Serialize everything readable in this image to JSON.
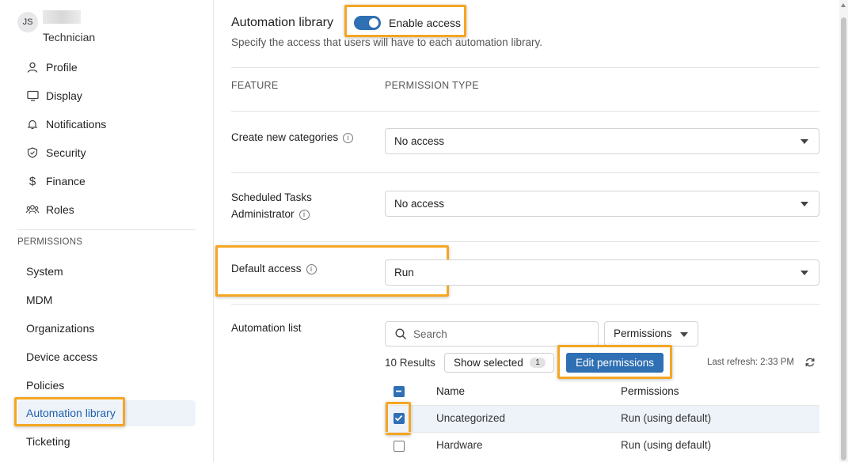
{
  "user": {
    "initials": "JS",
    "role": "Technician"
  },
  "sidebar": {
    "items": [
      {
        "label": "Profile",
        "icon": "person-icon"
      },
      {
        "label": "Display",
        "icon": "monitor-icon"
      },
      {
        "label": "Notifications",
        "icon": "bell-icon"
      },
      {
        "label": "Security",
        "icon": "shield-icon"
      },
      {
        "label": "Finance",
        "icon": "dollar-icon"
      },
      {
        "label": "Roles",
        "icon": "users-icon"
      }
    ],
    "permissions_header": "PERMISSIONS",
    "permissions": [
      "System",
      "MDM",
      "Organizations",
      "Device access",
      "Policies",
      "Automation library",
      "Ticketing"
    ],
    "active": "Automation library"
  },
  "main": {
    "title": "Automation library",
    "toggle_label": "Enable access",
    "toggle_on": true,
    "subtitle": "Specify the access that users will have to each automation library.",
    "columns": {
      "feature": "FEATURE",
      "permission_type": "PERMISSION TYPE"
    },
    "features": [
      {
        "label": "Create new categories",
        "value": "No access"
      },
      {
        "label_line1": "Scheduled Tasks",
        "label_line2": "Administrator",
        "value": "No access"
      },
      {
        "label": "Default access",
        "value": "Run"
      }
    ],
    "automation_list": {
      "label": "Automation list",
      "search_placeholder": "Search",
      "permissions_dropdown": "Permissions",
      "results": "10 Results",
      "show_selected": "Show selected",
      "selected_count": "1",
      "edit_permissions": "Edit permissions",
      "last_refresh": "Last refresh: 2:33 PM",
      "table_headers": {
        "name": "Name",
        "permissions": "Permissions"
      },
      "rows": [
        {
          "name": "Uncategorized",
          "permission": "Run (using default)",
          "checked": true
        },
        {
          "name": "Hardware",
          "permission": "Run (using default)",
          "checked": false
        }
      ]
    }
  },
  "colors": {
    "accent": "#2f6fb3",
    "highlight": "#f5a623",
    "active_bg": "#eef3fa"
  }
}
